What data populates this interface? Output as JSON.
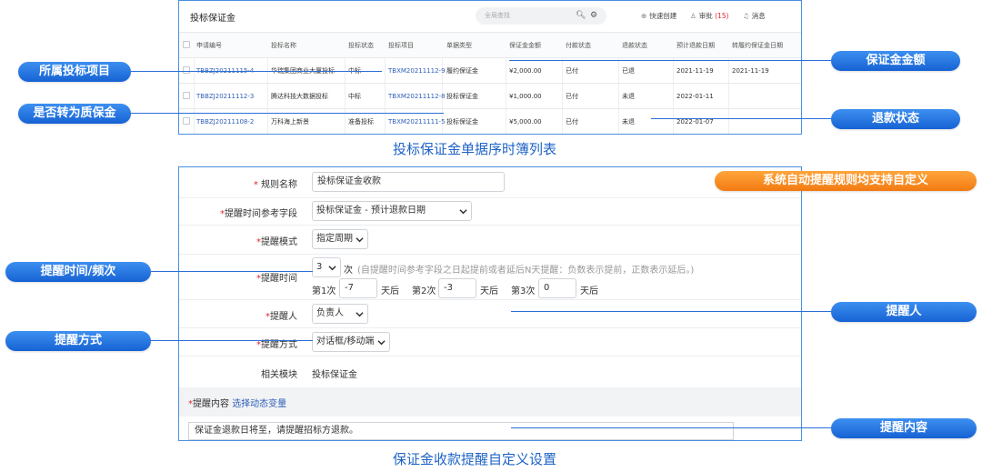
{
  "list_window": {
    "title": "投标保证金",
    "search_placeholder": "全局查找",
    "search_icon": "search-icon",
    "settings_icon": "gear-icon",
    "toolbar": {
      "quick_create": "快速创建",
      "approval": "审批",
      "approval_count": "(15)",
      "messages": "消息"
    },
    "columns": [
      "申请编号",
      "投标名称",
      "投标状态",
      "投标项目",
      "单据类型",
      "保证金金额",
      "付款状态",
      "退款状态",
      "预计退款日期",
      "转履约保证金日期"
    ],
    "rows": [
      [
        "TBBZJ20211115-4",
        "华瑞集团商业大厦投标",
        "中标",
        "TBXM20211112-9",
        "履约保证金",
        "¥2,000.00",
        "已付",
        "已退",
        "2021-11-19",
        "2021-11-19"
      ],
      [
        "TBBZJ20211112-3",
        "腾达科技大数据投标",
        "中标",
        "TBXM20211112-8",
        "投标保证金",
        "¥1,000.00",
        "已付",
        "未退",
        "2022-01-11",
        ""
      ],
      [
        "TBBZJ20211108-2",
        "万科海上新景",
        "准备投标",
        "TBXM20211111-5",
        "投标保证金",
        "¥5,000.00",
        "已付",
        "未退",
        "2022-01-07",
        ""
      ]
    ]
  },
  "captions": {
    "top": "投标保证金单据序时簿列表",
    "bottom": "保证金收款提醒自定义设置"
  },
  "rule_form": {
    "rule_name_label": "规则名称",
    "rule_name_value": "投标保证金收款",
    "ref_field_label": "提醒时间参考字段",
    "ref_field_value": "投标保证金 - 预计退款日期",
    "mode_label": "提醒模式",
    "mode_value": "指定周期",
    "time_label": "提醒时间",
    "times_value": "3",
    "times_unit": "次",
    "times_hint": "(自提醒时间参考字段之日起提前或者延后N天提醒：负数表示提前，正数表示延后。)",
    "schedule": [
      {
        "label": "第1次",
        "value": "-7",
        "unit": "天后"
      },
      {
        "label": "第2次",
        "value": "-3",
        "unit": "天后"
      },
      {
        "label": "第3次",
        "value": "0",
        "unit": "天后"
      }
    ],
    "person_label": "提醒人",
    "person_value": "负责人",
    "method_label": "提醒方式",
    "method_value": "对话框/移动端",
    "module_label": "相关模块",
    "module_value": "投标保证金",
    "content_label": "提醒内容",
    "content_link": "选择动态变量",
    "content_value": "保证金退款日将至，请提醒招标方退款。",
    "required_mark": "*"
  },
  "callouts": {
    "project": "所属投标项目",
    "quality_deposit": "是否转为质保金",
    "amount": "保证金金额",
    "refund_status": "退款状态",
    "custom_rules": "系统自动提醒规则均支持自定义",
    "time_freq": "提醒时间/频次",
    "reminder_person": "提醒人",
    "reminder_method": "提醒方式",
    "reminder_content": "提醒内容"
  },
  "colors": {
    "accent_blue": "#1662d4",
    "accent_orange": "#f27a12",
    "link": "#2f5eb8",
    "required": "#e0262e"
  }
}
